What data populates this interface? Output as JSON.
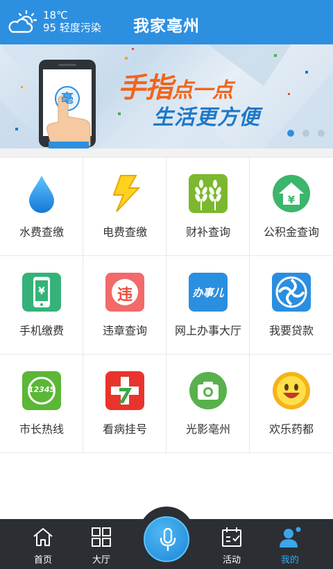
{
  "header": {
    "title": "我家亳州",
    "weather": {
      "temp": "18℃",
      "aqi": "95 轻度污染",
      "icon": "cloud-sun-icon"
    }
  },
  "banner": {
    "slogan_line1_big": "手指",
    "slogan_line1_small": "点一点",
    "slogan_line2": "生活更方便",
    "phone_badge": "亳",
    "pages": 3,
    "active_page": 1
  },
  "grid": {
    "items": [
      {
        "label": "水费查缴",
        "icon": "water-drop-icon"
      },
      {
        "label": "电费查缴",
        "icon": "lightning-icon"
      },
      {
        "label": "财补查询",
        "icon": "wheat-icon"
      },
      {
        "label": "公积金查询",
        "icon": "house-yuan-icon"
      },
      {
        "label": "手机缴费",
        "icon": "phone-yuan-icon"
      },
      {
        "label": "违章查询",
        "icon": "violation-icon",
        "badge": "违"
      },
      {
        "label": "网上办事大厅",
        "icon": "online-office-icon",
        "badge": "办事儿"
      },
      {
        "label": "我要贷款",
        "icon": "loan-icon"
      },
      {
        "label": "市长热线",
        "icon": "hotline-icon",
        "badge": "12345"
      },
      {
        "label": "看病挂号",
        "icon": "medical-icon"
      },
      {
        "label": "光影亳州",
        "icon": "camera-icon"
      },
      {
        "label": "欢乐药都",
        "icon": "smiley-icon"
      }
    ]
  },
  "nav": {
    "items": [
      {
        "label": "首页",
        "icon": "home-icon"
      },
      {
        "label": "大厅",
        "icon": "grid-icon"
      },
      {
        "label": "活动",
        "icon": "calendar-icon"
      },
      {
        "label": "我的",
        "icon": "user-icon",
        "active": true
      }
    ],
    "center": {
      "icon": "microphone-icon"
    }
  },
  "colors": {
    "primary": "#2d8fe0",
    "nav_bg": "#2b2f33",
    "active": "#3aa6ee"
  }
}
